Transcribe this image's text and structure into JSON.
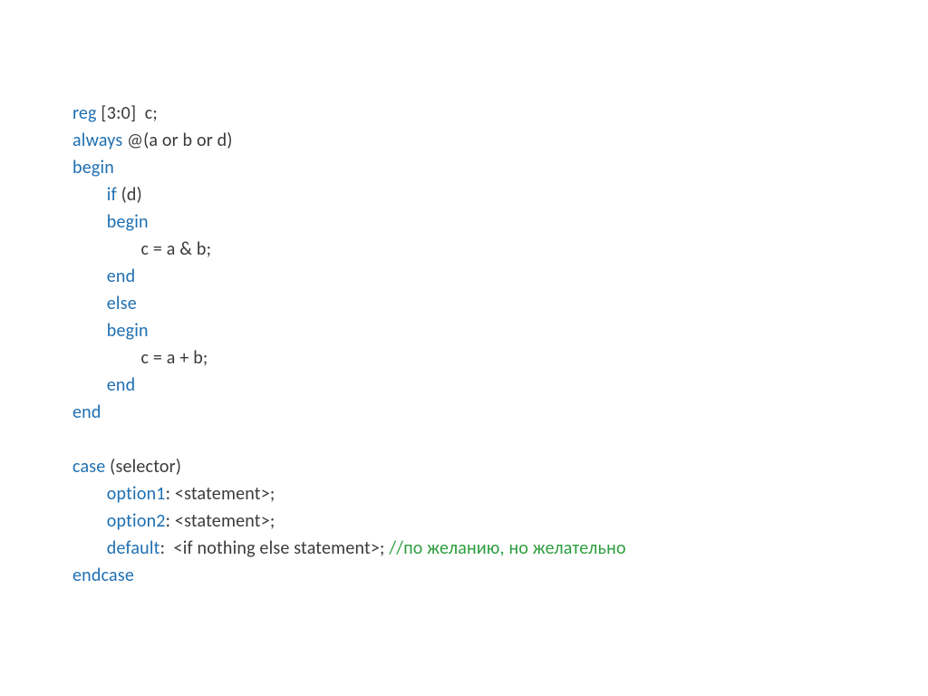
{
  "colors": {
    "keyword": "#1f6fb2",
    "text": "#3a3a3a",
    "comment": "#2e9e3f"
  },
  "code": {
    "l1_kw": "reg",
    "l1_tx": " [3:0]  c;",
    "l2_kw": "always",
    "l2_tx": " @(a or b or d)",
    "l3_kw": "begin",
    "l4_kw": "if",
    "l4_tx": " (d)",
    "l5_kw": "begin",
    "l6_tx": "c = a & b;",
    "l7_kw": "end",
    "l8_kw": "else",
    "l9_kw": "begin",
    "l10_tx": "c = a + b;",
    "l11_kw": "end",
    "l12_kw": "end",
    "l14_kw": "case",
    "l14_tx": " (selector)",
    "l15_kw": "option1",
    "l15_tx": ": <statement>;",
    "l16_kw": "option2",
    "l16_tx": ": <statement>;",
    "l17_kw": "default",
    "l17_tx1": ":  <if nothing else statement>; ",
    "l17_cmt": "//по желанию, но желательно",
    "l18_kw": "endcase"
  },
  "indent": {
    "i0": "",
    "i1": "\t",
    "i2": "\t\t"
  }
}
